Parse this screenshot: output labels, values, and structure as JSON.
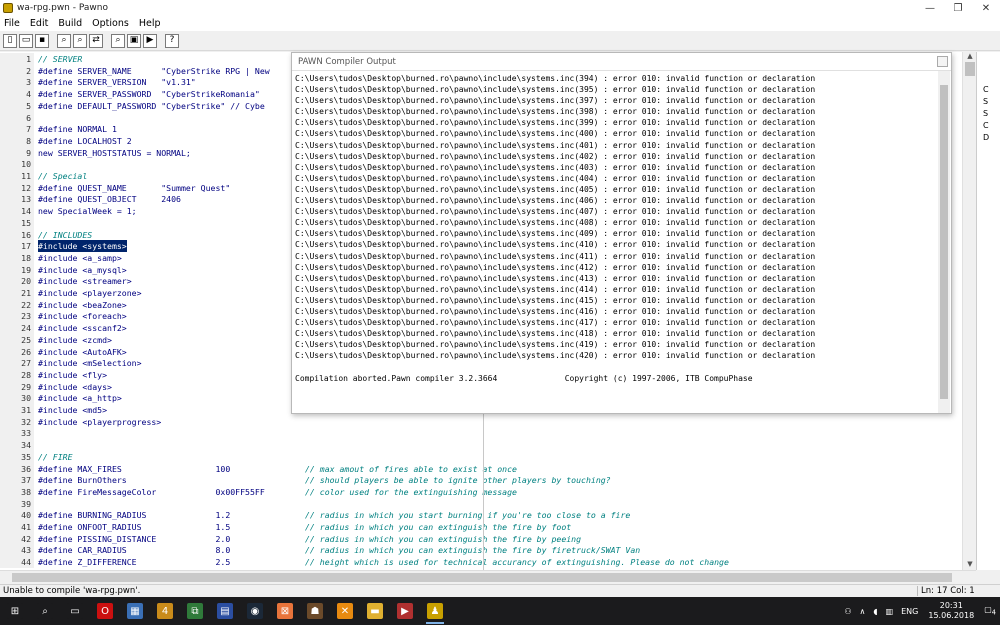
{
  "window": {
    "title": "wa-rpg.pwn - Pawno",
    "min_label": "—",
    "max_label": "❐",
    "close_label": "✕"
  },
  "menu": [
    "File",
    "Edit",
    "Build",
    "Options",
    "Help"
  ],
  "toolbar": {
    "icons": [
      "new-file-icon",
      "open-file-icon",
      "save-file-icon",
      "find-icon",
      "find-next-icon",
      "replace-icon",
      "goto-icon",
      "compile-icon",
      "run-icon",
      "help-icon"
    ],
    "glyphs": [
      "▯",
      "▭",
      "▪",
      "⌕",
      "⌕",
      "⇄",
      "⌕",
      "▣",
      "▶",
      "?"
    ]
  },
  "editor": {
    "lines": [
      {
        "n": "1",
        "t": "// SERVER",
        "c": true
      },
      {
        "n": "2",
        "t": "#define SERVER_NAME      \"CyberStrike RPG | New"
      },
      {
        "n": "3",
        "t": "#define SERVER_VERSION   \"v1.31\""
      },
      {
        "n": "4",
        "t": "#define SERVER_PASSWORD  \"CyberStrikeRomania\""
      },
      {
        "n": "5",
        "t": "#define DEFAULT_PASSWORD \"CyberStrike\" // Cybe"
      },
      {
        "n": "6",
        "t": ""
      },
      {
        "n": "7",
        "t": "#define NORMAL 1"
      },
      {
        "n": "8",
        "t": "#define LOCALHOST 2"
      },
      {
        "n": "9",
        "t": "new SERVER_HOSTSTATUS = NORMAL;"
      },
      {
        "n": "10",
        "t": ""
      },
      {
        "n": "11",
        "t": "// Special",
        "c": true
      },
      {
        "n": "12",
        "t": "#define QUEST_NAME       \"Summer Quest\""
      },
      {
        "n": "13",
        "t": "#define QUEST_OBJECT     2406"
      },
      {
        "n": "14",
        "t": "new SpecialWeek = 1;"
      },
      {
        "n": "15",
        "t": ""
      },
      {
        "n": "16",
        "t": "// INCLUDES",
        "c": true
      },
      {
        "n": "17",
        "t": "#include <systems>",
        "s": true
      },
      {
        "n": "18",
        "t": "#include <a_samp>"
      },
      {
        "n": "19",
        "t": "#include <a_mysql>"
      },
      {
        "n": "20",
        "t": "#include <streamer>"
      },
      {
        "n": "21",
        "t": "#include <playerzone>"
      },
      {
        "n": "22",
        "t": "#include <beaZone>"
      },
      {
        "n": "23",
        "t": "#include <foreach>"
      },
      {
        "n": "24",
        "t": "#include <sscanf2>"
      },
      {
        "n": "25",
        "t": "#include <zcmd>"
      },
      {
        "n": "26",
        "t": "#include <AutoAFK>"
      },
      {
        "n": "27",
        "t": "#include <mSelection>"
      },
      {
        "n": "28",
        "t": "#include <fly>"
      },
      {
        "n": "29",
        "t": "#include <days>"
      },
      {
        "n": "30",
        "t": "#include <a_http>"
      },
      {
        "n": "31",
        "t": "#include <md5>"
      },
      {
        "n": "32",
        "t": "#include <playerprogress>"
      },
      {
        "n": "33",
        "t": ""
      },
      {
        "n": "34",
        "t": ""
      },
      {
        "n": "35",
        "t": "// FIRE",
        "c": true
      },
      {
        "n": "36",
        "t": "#define MAX_FIRES                   100",
        "m": "// max amout of fires able to exist at once"
      },
      {
        "n": "37",
        "t": "#define BurnOthers",
        "m": "// should players be able to ignite other players by touching?"
      },
      {
        "n": "38",
        "t": "#define FireMessageColor            0x00FF55FF",
        "m": "// color used for the extinguishing message"
      },
      {
        "n": "39",
        "t": ""
      },
      {
        "n": "40",
        "t": "#define BURNING_RADIUS              1.2",
        "m": "// radius in which you start burning if you're too close to a fire"
      },
      {
        "n": "41",
        "t": "#define ONFOOT_RADIUS               1.5",
        "m": "// radius in which you can extinguish the fire by foot"
      },
      {
        "n": "42",
        "t": "#define PISSING_DISTANCE            2.0",
        "m": "// radius in which you can extinguish the fire by peeing"
      },
      {
        "n": "43",
        "t": "#define CAR_RADIUS                  8.0",
        "m": "// radius in which you can extinguish the fire by firetruck/SWAT Van"
      },
      {
        "n": "44",
        "t": "#define Z_DIFFERENCE                2.5",
        "m": "// height which is used for technical accurancy of extinguishing. Please do not change"
      }
    ]
  },
  "right_panel": [
    "C",
    "S",
    "S",
    "C",
    "D"
  ],
  "compiler_output": {
    "title": "PAWN Compiler Output",
    "errors": [
      "C:\\Users\\tudos\\Desktop\\burned.ro\\pawno\\include\\systems.inc(394) : error 010: invalid function or declaration",
      "C:\\Users\\tudos\\Desktop\\burned.ro\\pawno\\include\\systems.inc(395) : error 010: invalid function or declaration",
      "C:\\Users\\tudos\\Desktop\\burned.ro\\pawno\\include\\systems.inc(397) : error 010: invalid function or declaration",
      "C:\\Users\\tudos\\Desktop\\burned.ro\\pawno\\include\\systems.inc(398) : error 010: invalid function or declaration",
      "C:\\Users\\tudos\\Desktop\\burned.ro\\pawno\\include\\systems.inc(399) : error 010: invalid function or declaration",
      "C:\\Users\\tudos\\Desktop\\burned.ro\\pawno\\include\\systems.inc(400) : error 010: invalid function or declaration",
      "C:\\Users\\tudos\\Desktop\\burned.ro\\pawno\\include\\systems.inc(401) : error 010: invalid function or declaration",
      "C:\\Users\\tudos\\Desktop\\burned.ro\\pawno\\include\\systems.inc(402) : error 010: invalid function or declaration",
      "C:\\Users\\tudos\\Desktop\\burned.ro\\pawno\\include\\systems.inc(403) : error 010: invalid function or declaration",
      "C:\\Users\\tudos\\Desktop\\burned.ro\\pawno\\include\\systems.inc(404) : error 010: invalid function or declaration",
      "C:\\Users\\tudos\\Desktop\\burned.ro\\pawno\\include\\systems.inc(405) : error 010: invalid function or declaration",
      "C:\\Users\\tudos\\Desktop\\burned.ro\\pawno\\include\\systems.inc(406) : error 010: invalid function or declaration",
      "C:\\Users\\tudos\\Desktop\\burned.ro\\pawno\\include\\systems.inc(407) : error 010: invalid function or declaration",
      "C:\\Users\\tudos\\Desktop\\burned.ro\\pawno\\include\\systems.inc(408) : error 010: invalid function or declaration",
      "C:\\Users\\tudos\\Desktop\\burned.ro\\pawno\\include\\systems.inc(409) : error 010: invalid function or declaration",
      "C:\\Users\\tudos\\Desktop\\burned.ro\\pawno\\include\\systems.inc(410) : error 010: invalid function or declaration",
      "C:\\Users\\tudos\\Desktop\\burned.ro\\pawno\\include\\systems.inc(411) : error 010: invalid function or declaration",
      "C:\\Users\\tudos\\Desktop\\burned.ro\\pawno\\include\\systems.inc(412) : error 010: invalid function or declaration",
      "C:\\Users\\tudos\\Desktop\\burned.ro\\pawno\\include\\systems.inc(413) : error 010: invalid function or declaration",
      "C:\\Users\\tudos\\Desktop\\burned.ro\\pawno\\include\\systems.inc(414) : error 010: invalid function or declaration",
      "C:\\Users\\tudos\\Desktop\\burned.ro\\pawno\\include\\systems.inc(415) : error 010: invalid function or declaration",
      "C:\\Users\\tudos\\Desktop\\burned.ro\\pawno\\include\\systems.inc(416) : error 010: invalid function or declaration",
      "C:\\Users\\tudos\\Desktop\\burned.ro\\pawno\\include\\systems.inc(417) : error 010: invalid function or declaration",
      "C:\\Users\\tudos\\Desktop\\burned.ro\\pawno\\include\\systems.inc(418) : error 010: invalid function or declaration",
      "C:\\Users\\tudos\\Desktop\\burned.ro\\pawno\\include\\systems.inc(419) : error 010: invalid function or declaration",
      "C:\\Users\\tudos\\Desktop\\burned.ro\\pawno\\include\\systems.inc(420) : error 010: invalid function or declaration"
    ],
    "blank": "",
    "footer": "Compilation aborted.Pawn compiler 3.2.3664              Copyright (c) 1997-2006, ITB CompuPhase"
  },
  "status": {
    "message": "Unable to compile 'wa-rpg.pwn'.",
    "position": "Ln: 17  Col: 1"
  },
  "taskbar": {
    "apps": [
      {
        "name": "start-icon",
        "glyph": "⊞",
        "color": "#1b1b1d"
      },
      {
        "name": "search-icon",
        "glyph": "⌕",
        "color": "#1b1b1d"
      },
      {
        "name": "task-view-icon",
        "glyph": "▭",
        "color": "#1b1b1d"
      },
      {
        "name": "opera-icon",
        "glyph": "O",
        "color": "#cc1010"
      },
      {
        "name": "calculator-icon",
        "glyph": "▦",
        "color": "#3a6fb5"
      },
      {
        "name": "app-400-icon",
        "glyph": "4",
        "color": "#c98b1a"
      },
      {
        "name": "file-copy-icon",
        "glyph": "⧉",
        "color": "#2f7a3a"
      },
      {
        "name": "network-icon",
        "glyph": "▤",
        "color": "#2b4ea1"
      },
      {
        "name": "steam-icon",
        "glyph": "◉",
        "color": "#1b2838"
      },
      {
        "name": "xampp-icon",
        "glyph": "⊠",
        "color": "#e8743b"
      },
      {
        "name": "game-icon",
        "glyph": "☗",
        "color": "#6b4a2a"
      },
      {
        "name": "x-app-icon",
        "glyph": "✕",
        "color": "#e88a10"
      },
      {
        "name": "folder-icon",
        "glyph": "▬",
        "color": "#e0b030"
      },
      {
        "name": "media-icon",
        "glyph": "▶",
        "color": "#b03030"
      },
      {
        "name": "pawno-icon",
        "glyph": "♟",
        "color": "#c8a000"
      }
    ],
    "tray": {
      "lang": "ENG",
      "time": "20:31",
      "date": "15.06.2018",
      "notifications": "4"
    }
  }
}
